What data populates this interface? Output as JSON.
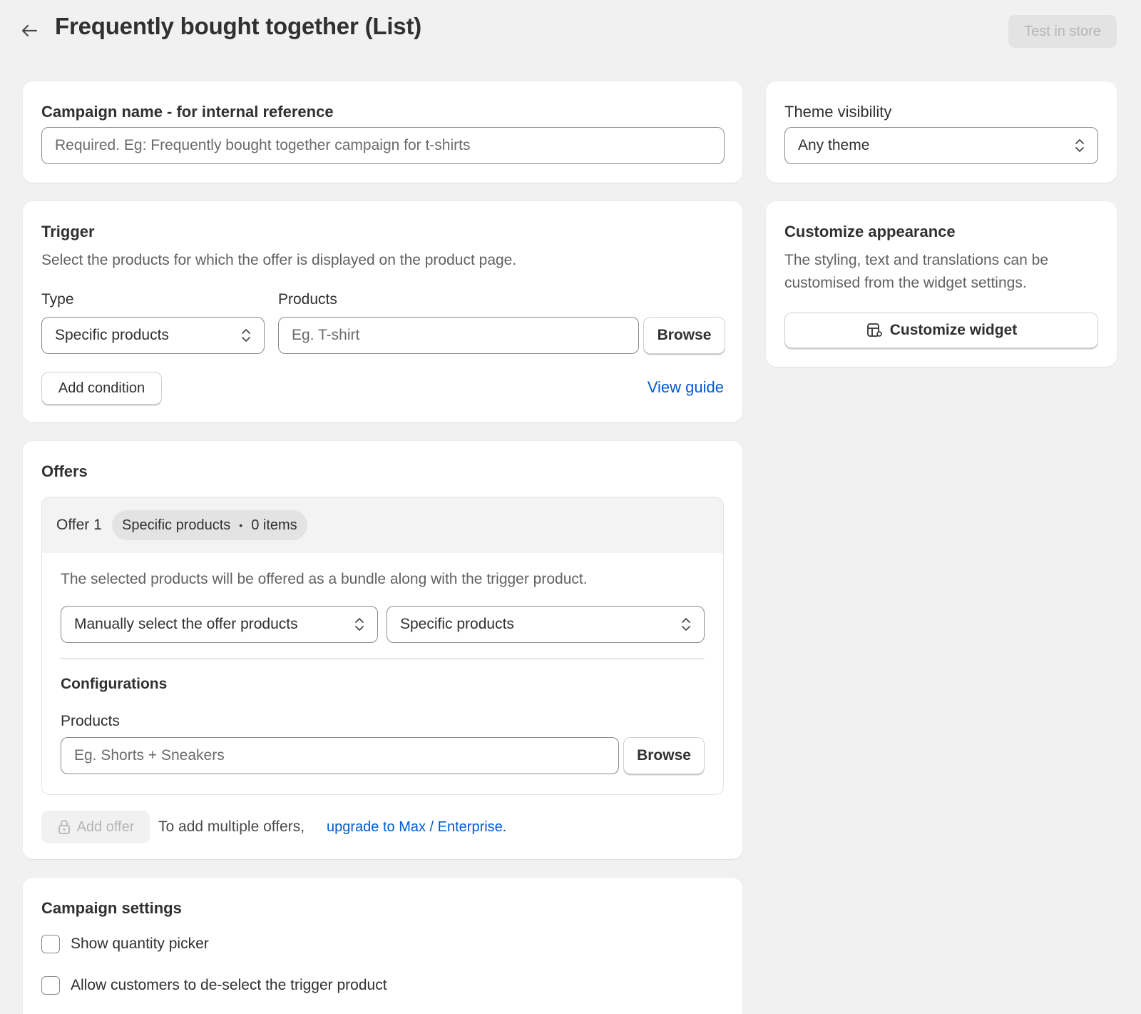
{
  "header": {
    "title": "Frequently bought together (List)",
    "test_button": "Test in store"
  },
  "campaign_name": {
    "label": "Campaign name - for internal reference",
    "placeholder": "Required. Eg: Frequently bought together campaign for t-shirts",
    "value": ""
  },
  "theme_visibility": {
    "label": "Theme visibility",
    "selected": "Any theme"
  },
  "trigger": {
    "title": "Trigger",
    "description": "Select the products for which the offer is displayed on the product page.",
    "type_label": "Type",
    "type_selected": "Specific products",
    "products_label": "Products",
    "products_placeholder": "Eg. T-shirt",
    "browse_label": "Browse",
    "add_condition_label": "Add condition",
    "view_guide_label": "View guide"
  },
  "customize": {
    "title": "Customize appearance",
    "description": "The styling, text and translations can be customised from the widget settings.",
    "button_label": "Customize widget"
  },
  "offers": {
    "title": "Offers",
    "offer1": {
      "name": "Offer 1",
      "badge_type": "Specific products",
      "badge_separator": "•",
      "badge_count": "0 items",
      "description": "The selected products will be offered as a bundle along with the trigger product.",
      "mode_selected": "Manually select the offer products",
      "scope_selected": "Specific products",
      "configurations_title": "Configurations",
      "products_label": "Products",
      "products_placeholder": "Eg. Shorts + Sneakers",
      "browse_label": "Browse"
    },
    "add_offer_label": "Add offer",
    "upgrade_text": "To add multiple offers,",
    "upgrade_link": "upgrade to Max / Enterprise."
  },
  "campaign_settings": {
    "title": "Campaign settings",
    "options": [
      {
        "label": "Show quantity picker",
        "checked": false
      },
      {
        "label": "Allow customers to de-select the trigger product",
        "checked": false
      }
    ]
  },
  "colors": {
    "background": "#f1f1f1",
    "card": "#ffffff",
    "link": "#005bd3",
    "text": "#303030",
    "muted": "#616161",
    "disabled": "#b5b5b5"
  }
}
